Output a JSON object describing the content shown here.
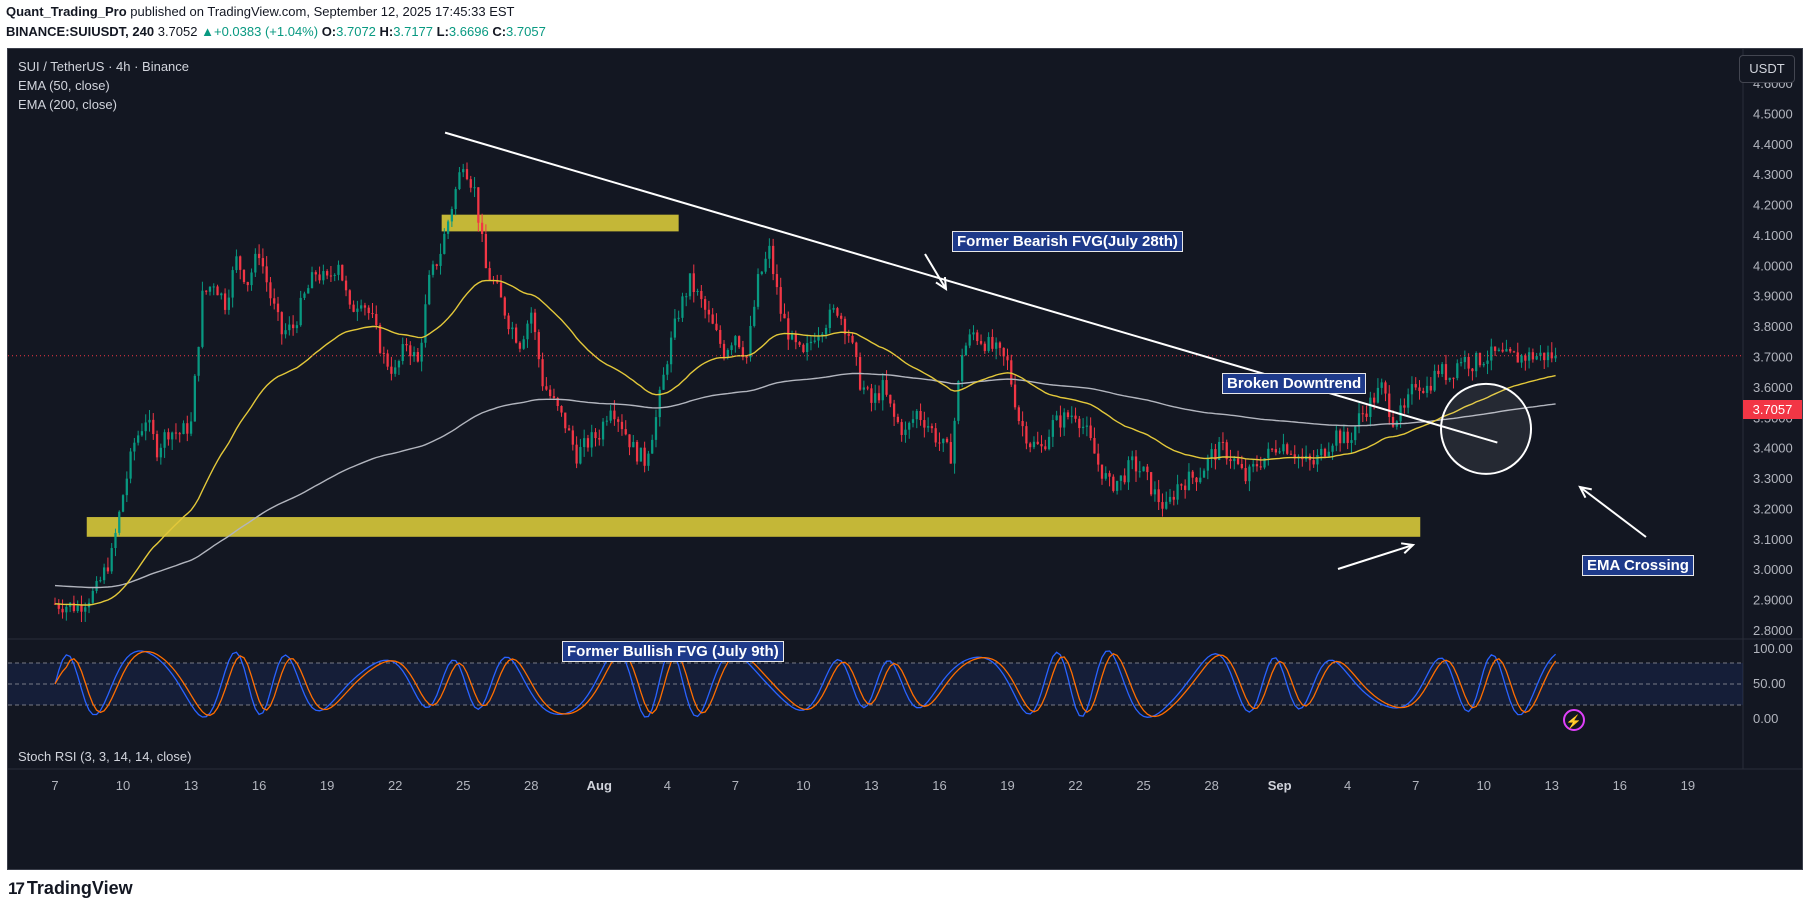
{
  "header": {
    "author": "Quant_Trading_Pro",
    "published_text": "published on TradingView.com, September 12, 2025 17:45:33 EST",
    "symbol_line": "BINANCE:SUIUSDT, 240",
    "last": "3.7052",
    "change": "+0.0383 (+1.04%)",
    "o_label": "O:",
    "o": "3.7072",
    "h_label": "H:",
    "h": "3.7177",
    "l_label": "L:",
    "l": "3.6696",
    "c_label": "C:",
    "c": "3.7057"
  },
  "legend": {
    "title": "SUI / TetherUS · 4h · Binance",
    "ema50": "EMA (50, close)",
    "ema200": "EMA (200, close)",
    "stoch": "Stoch RSI (3, 3, 14, 14, close)"
  },
  "currency_button": "USDT",
  "current_price_label": "3.7057",
  "footer": {
    "logo_text": "TradingView"
  },
  "annotations": {
    "bearish_fvg": "Former Bearish FVG(July 28th)",
    "bullish_fvg": "Former Bullish FVG (July 9th)",
    "broken_downtrend": "Broken Downtrend",
    "ema_crossing": "EMA Crossing"
  },
  "colors": {
    "background": "#131722",
    "up": "#089981",
    "down": "#f23645",
    "ema50": "#e3c83a",
    "ema200": "#b2b5be",
    "fvg_zone": "#d4c63a",
    "stoch_k": "#2962ff",
    "stoch_d": "#ff6d00",
    "label_bg": "#1e3a8a"
  },
  "chart_data": [
    {
      "type": "candlestick",
      "title": "SUI / TetherUS · 4h · Binance",
      "x_ticks": [
        "7",
        "10",
        "13",
        "16",
        "19",
        "22",
        "25",
        "28",
        "Aug",
        "4",
        "7",
        "10",
        "13",
        "16",
        "19",
        "22",
        "25",
        "28",
        "Sep",
        "4",
        "7",
        "10",
        "13",
        "16",
        "19"
      ],
      "y_ticks": [
        "2.8000",
        "2.9000",
        "3.0000",
        "3.1000",
        "3.2000",
        "3.3000",
        "3.4000",
        "3.5000",
        "3.6000",
        "3.7000",
        "3.8000",
        "3.9000",
        "4.0000",
        "4.1000",
        "4.2000",
        "4.3000",
        "4.4000",
        "4.5000",
        "4.6000"
      ],
      "ylim": [
        2.78,
        4.66
      ],
      "price_path_keypoints": {
        "x_days_from_jul7": [
          0,
          1,
          1.8,
          2.5,
          3,
          3.5,
          4,
          4.5,
          5,
          5.5,
          6,
          6.5,
          7,
          7.5,
          8,
          8.5,
          9,
          9.5,
          10,
          10.5,
          11,
          11.5,
          12,
          12.5,
          13,
          13.5,
          14,
          14.5,
          15,
          15.5,
          16,
          16.5,
          17,
          17.5,
          18,
          18.5,
          19,
          19.5,
          20,
          20.5,
          21,
          21.5,
          22,
          22.5,
          23,
          23.5,
          24,
          24.5,
          25,
          25.5,
          26,
          26.5,
          27,
          27.5,
          28,
          28.5,
          29,
          29.5,
          30,
          30.5,
          31,
          31.5,
          32,
          32.5,
          33,
          33.5,
          34,
          34.5,
          35,
          35.5,
          36,
          36.5,
          37,
          37.5,
          38,
          38.5,
          39,
          39.5,
          40,
          40.5,
          41,
          41.5,
          42,
          42.5,
          43,
          43.5,
          44,
          44.5,
          45,
          45.5,
          46,
          46.5,
          47,
          47.5,
          48,
          48.5,
          49,
          49.5,
          50,
          50.5,
          51,
          51.5,
          52,
          52.5,
          53,
          53.5,
          54,
          54.5,
          55,
          55.5,
          56,
          56.5,
          57,
          57.5,
          58,
          58.5,
          59,
          59.5,
          60,
          60.5,
          61,
          61.5,
          62,
          62.5,
          63,
          63.5,
          64,
          64.5,
          65,
          65.5,
          66,
          66.2
        ],
        "close": [
          2.89,
          2.88,
          2.93,
          3.05,
          3.25,
          3.42,
          3.5,
          3.4,
          3.46,
          3.45,
          3.48,
          3.9,
          3.95,
          3.88,
          4.02,
          3.95,
          4.05,
          3.9,
          3.78,
          3.8,
          3.9,
          3.98,
          3.95,
          4.02,
          3.85,
          3.9,
          3.82,
          3.7,
          3.65,
          3.75,
          3.68,
          3.95,
          4.05,
          4.2,
          4.35,
          4.25,
          3.99,
          3.92,
          3.82,
          3.75,
          3.85,
          3.62,
          3.55,
          3.48,
          3.38,
          3.42,
          3.45,
          3.55,
          3.48,
          3.4,
          3.36,
          3.5,
          3.7,
          3.85,
          3.95,
          3.88,
          3.8,
          3.72,
          3.78,
          3.7,
          3.95,
          4.05,
          3.85,
          3.75,
          3.7,
          3.78,
          3.82,
          3.86,
          3.78,
          3.62,
          3.55,
          3.6,
          3.5,
          3.45,
          3.52,
          3.48,
          3.42,
          3.38,
          3.72,
          3.78,
          3.75,
          3.72,
          3.68,
          3.5,
          3.42,
          3.4,
          3.48,
          3.5,
          3.52,
          3.45,
          3.35,
          3.28,
          3.3,
          3.35,
          3.32,
          3.25,
          3.2,
          3.28,
          3.3,
          3.32,
          3.38,
          3.4,
          3.36,
          3.3,
          3.35,
          3.38,
          3.42,
          3.4,
          3.36,
          3.35,
          3.4,
          3.45,
          3.42,
          3.5,
          3.55,
          3.6,
          3.5,
          3.52,
          3.62,
          3.6,
          3.66,
          3.64,
          3.7,
          3.68,
          3.7,
          3.71,
          3.7,
          3.7,
          3.705,
          3.7057,
          3.7057,
          3.7057,
          3.7057
        ]
      },
      "current_price": 3.7057
    },
    {
      "type": "line",
      "title": "Stoch RSI (3, 3, 14, 14, close)",
      "y_ticks": [
        "100.00",
        "50.00",
        "0.00"
      ],
      "ylim": [
        -5,
        105
      ],
      "bands": [
        20,
        80
      ]
    }
  ]
}
